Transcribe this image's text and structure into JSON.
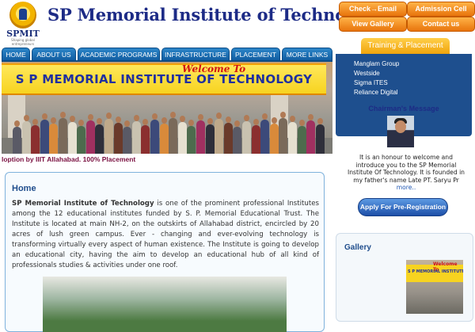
{
  "header": {
    "logo_text": "SPMIT",
    "logo_tagline": "Shaping global entrepreneurs",
    "site_title": "SP Memorial Institute of Technology"
  },
  "top_buttons": {
    "check_email": "Check→Email",
    "admission_cell": "Admission Cell",
    "view_gallery": "View Gallery",
    "contact_us": "Contact us"
  },
  "nav": {
    "items": [
      "HOME",
      "ABOUT US",
      "ACADEMIC PROGRAMS",
      "INFRASTRUCTURE",
      "PLACEMENT",
      "MORE LINKS"
    ]
  },
  "banner": {
    "welcome": "Welcome To",
    "sign": "S P MEMORIAL INSTITUTE OF TECHNOLOGY"
  },
  "ticker": {
    "text": "loption by IIIT Allahabad.          100% Placement"
  },
  "home": {
    "title": "Home",
    "lead": "SP Memorial Institute of Technology",
    "body": " is one of the prominent professional Institutes among the 12 educational institutes funded by S. P. Memorial Educational Trust. The Institute is located at main NH-2, on the outskirts of Allahabad district, encircled by 20 acres of lush green campus. Ever - changing and ever-evolving technology is transforming virtually every aspect of human existence. The Institute is going to develop an educational city, having the aim to develop an educational hub of all kind of professionals studies & activities under one roof."
  },
  "training": {
    "title": "Training & Placement",
    "items": [
      "Manglam Group",
      "Westside",
      "Sigma ITES",
      "Reliance Digital"
    ]
  },
  "chairman": {
    "title": "Chairman's Message",
    "text": "It is an honour to welcome and introduce you to the SP Memorial Institute Of Technology. It is founded in my father's name Late PT. Saryu Pr",
    "more": "more.."
  },
  "apply_button": "Apply For Pre-Registration",
  "gallery": {
    "title": "Gallery"
  },
  "colors": {
    "brand_blue": "#1d2b86",
    "nav_blue": "#1f6fb5",
    "orange": "#f08a1c",
    "ticker": "#7a1040"
  }
}
